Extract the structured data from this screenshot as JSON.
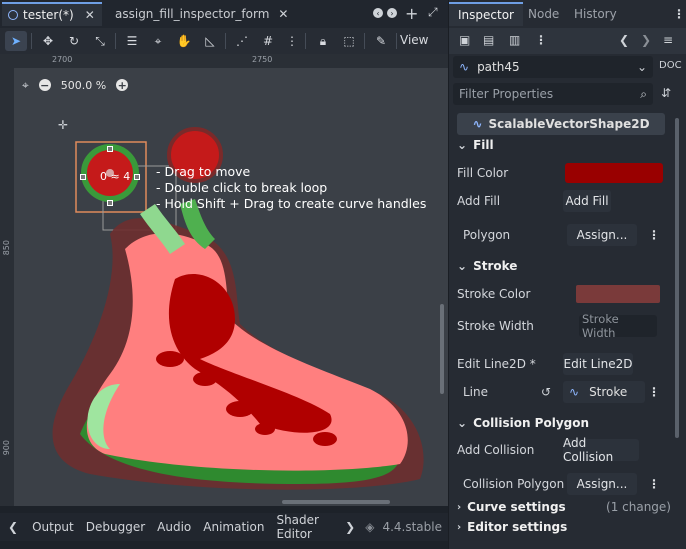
{
  "editor": {
    "tabs": [
      {
        "label": "tester(*)",
        "icon": "scene-icon"
      },
      {
        "label": "assign_fill_inspector_form",
        "icon": "script-icon"
      }
    ],
    "toolbar": {
      "view_label": "View"
    },
    "zoom": {
      "value": "500.0 %"
    },
    "ruler": {
      "top": [
        "2700",
        "2750"
      ],
      "left": [
        "850",
        "900"
      ]
    },
    "canvas": {
      "point_label": "0 ≈ 4",
      "hints": [
        "- Drag to move",
        "- Double click to break loop",
        "- Hold Shift + Drag to create curve handles"
      ],
      "colors": {
        "background": "#3b4047",
        "shape_fill": "#ff7a7a",
        "shape_dark": "#a00000",
        "leaf": "#3faa3f",
        "stroke": "#7a3a3a"
      }
    }
  },
  "bottom_panel": {
    "items": [
      "Output",
      "Debugger",
      "Audio",
      "Animation",
      "Shader Editor"
    ],
    "version": "4.4.stable"
  },
  "inspector": {
    "tabs": [
      "Inspector",
      "Node",
      "History"
    ],
    "node_name": "path45",
    "filter_placeholder": "Filter Properties",
    "class_name": "ScalableVectorShape2D",
    "fill": {
      "header": "Fill",
      "fill_color_label": "Fill Color",
      "fill_color": "#990000",
      "add_fill_label": "Add Fill",
      "add_fill_button": "Add Fill",
      "polygon_label": "Polygon",
      "polygon_button": "Assign..."
    },
    "stroke": {
      "header": "Stroke",
      "stroke_color_label": "Stroke Color",
      "stroke_color": "#7a3a3a",
      "stroke_width_label": "Stroke Width",
      "stroke_width_placeholder": "Stroke Width",
      "edit_line_label": "Edit Line2D *",
      "edit_line_button": "Edit Line2D",
      "line_label": "Line",
      "line_value": "Stroke"
    },
    "collision": {
      "header": "Collision Polygon",
      "add_collision_label": "Add Collision",
      "add_collision_button": "Add Collision",
      "collision_polygon_label": "Collision Polygon",
      "collision_polygon_button": "Assign..."
    },
    "curve_settings": {
      "label": "Curve settings",
      "note": "(1 change)"
    },
    "editor_settings": {
      "label": "Editor settings"
    }
  }
}
